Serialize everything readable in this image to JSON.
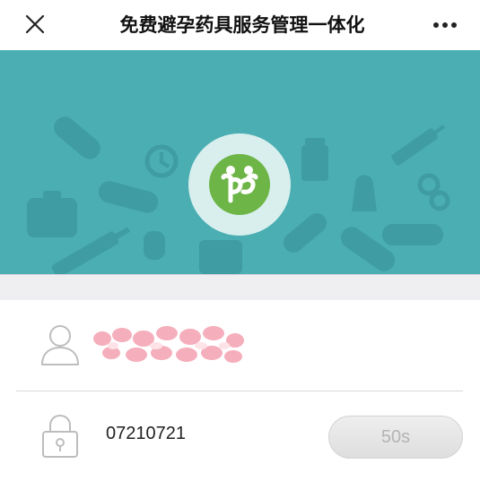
{
  "nav": {
    "title": "免费避孕药具服务管理一体化",
    "close_icon": "close-icon",
    "more_icon": "more-dots-icon"
  },
  "banner": {
    "background_color": "#4aaeb3",
    "logo_color": "#6cb546",
    "logo_icon": "app-logo-icon"
  },
  "login": {
    "user_icon": "user-icon",
    "lock_icon": "lock-icon",
    "code_value": "07210721",
    "countdown_label": "50s"
  }
}
